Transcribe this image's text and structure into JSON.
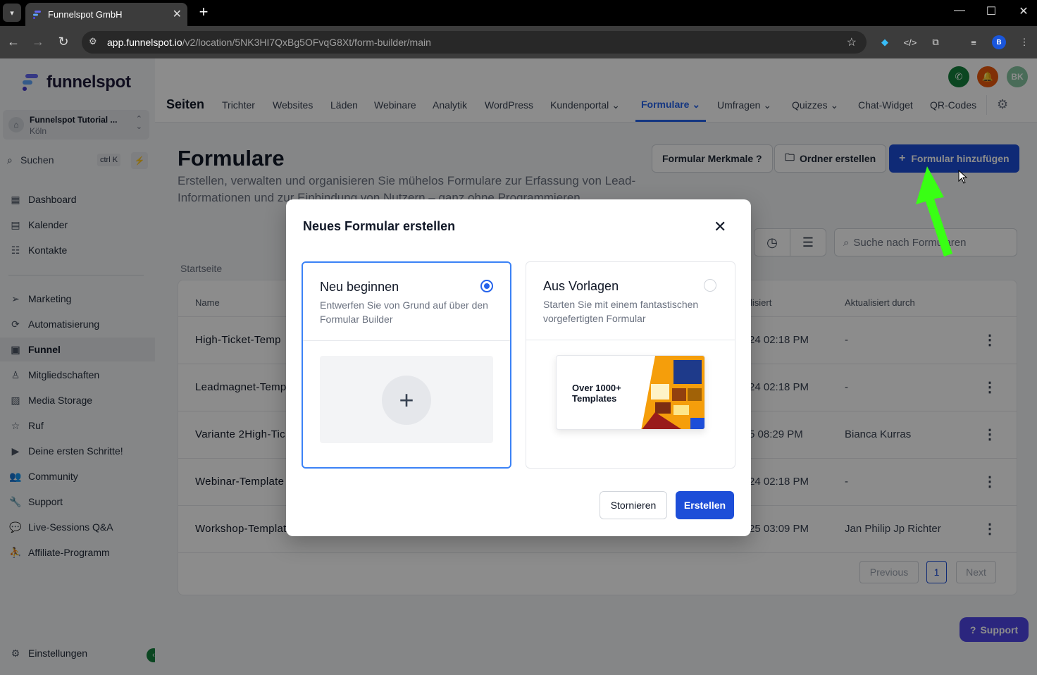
{
  "browser": {
    "tab_title": "Funnelspot GmbH",
    "url_host": "app.funnelspot.io",
    "url_path": "/v2/location/5NK3HI7QxBg5OFvqG8Xt/form-builder/main",
    "profile_initial": "B"
  },
  "sidebar": {
    "logo_text": "funnelspot",
    "account_name": "Funnelspot Tutorial ...",
    "account_location": "Köln",
    "search_label": "Suchen",
    "search_shortcut": "ctrl K",
    "items": [
      {
        "label": "Dashboard",
        "icon": "dashboard-icon"
      },
      {
        "label": "Kalender",
        "icon": "calendar-icon"
      },
      {
        "label": "Kontakte",
        "icon": "contacts-icon"
      },
      {
        "label": "Marketing",
        "icon": "send-icon"
      },
      {
        "label": "Automatisierung",
        "icon": "automation-icon"
      },
      {
        "label": "Funnel",
        "icon": "funnel-icon"
      },
      {
        "label": "Mitgliedschaften",
        "icon": "membership-icon"
      },
      {
        "label": "Media Storage",
        "icon": "image-icon"
      },
      {
        "label": "Ruf",
        "icon": "star-icon"
      },
      {
        "label": "Deine ersten Schritte!",
        "icon": "play-icon"
      },
      {
        "label": "Community",
        "icon": "users-icon"
      },
      {
        "label": "Support",
        "icon": "wrench-icon"
      },
      {
        "label": "Live-Sessions Q&A",
        "icon": "chat-icon"
      },
      {
        "label": "Affiliate-Programm",
        "icon": "affiliate-icon"
      }
    ],
    "settings_label": "Einstellungen"
  },
  "topnav": {
    "section": "Seiten",
    "avatar_initials": "BK",
    "items": [
      "Trichter",
      "Websites",
      "Läden",
      "Webinare",
      "Analytik",
      "WordPress",
      "Kundenportal",
      "Formulare",
      "Umfragen",
      "Quizzes",
      "Chat-Widget",
      "QR-Codes"
    ],
    "active": "Formulare"
  },
  "page": {
    "title": "Formulare",
    "description": "Erstellen, verwalten und organisieren Sie mühelos Formulare zur Erfassung von Lead-Informationen und zur Einbindung von Nutzern – ganz ohne Programmieren.",
    "btn_features": "Formular Merkmale ?",
    "btn_folder": "Ordner erstellen",
    "btn_add": "Formular hinzufügen",
    "search_placeholder": "Suche nach Formularen",
    "breadcrumb": "Startseite"
  },
  "table": {
    "col_name": "Name",
    "col_updated": "lisiert",
    "col_updated_by": "Aktualisiert durch",
    "rows": [
      {
        "name": "High-Ticket-Temp",
        "date": "24 02:18 PM",
        "user": "-"
      },
      {
        "name": "Leadmagnet-Temp",
        "date": "24 02:18 PM",
        "user": "-"
      },
      {
        "name": "Variante 2High-Tic",
        "date": "5 08:29 PM",
        "user": "Bianca Kurras"
      },
      {
        "name": "Webinar-Template",
        "date": "24 02:18 PM",
        "user": "-"
      },
      {
        "name": "Workshop-Templat",
        "date": "25 03:09 PM",
        "user": "Jan Philip Jp Richter"
      }
    ],
    "pager_prev": "Previous",
    "pager_page": "1",
    "pager_next": "Next"
  },
  "support_button": "Support",
  "modal": {
    "title": "Neues Formular erstellen",
    "option_new_title": "Neu beginnen",
    "option_new_desc": "Entwerfen Sie von Grund auf über den Formular Builder",
    "option_tpl_title": "Aus Vorlagen",
    "option_tpl_desc": "Starten Sie mit einem fantastischen vorgefertigten Formular",
    "tpl_preview_text": "Over 1000+ Templates",
    "selected_option": "new",
    "btn_cancel": "Stornieren",
    "btn_create": "Erstellen"
  },
  "colors": {
    "primary": "#1d4ed8",
    "selected_border": "#3b82f6",
    "annotation_arrow": "#39ff14"
  }
}
